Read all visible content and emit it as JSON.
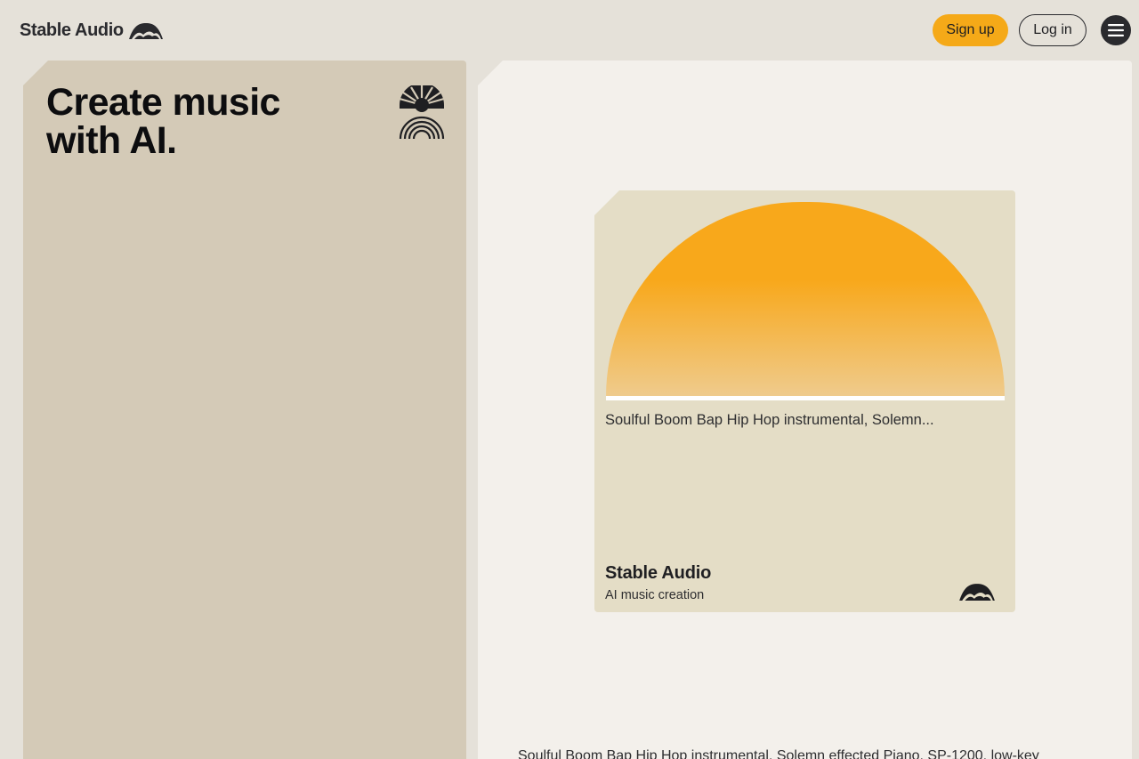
{
  "header": {
    "logo_text": "Stable Audio",
    "signup_label": "Sign up",
    "login_label": "Log in"
  },
  "hero": {
    "title": "Create music with AI."
  },
  "card": {
    "prompt": "Soulful Boom Bap Hip Hop instrumental, Solemn...",
    "brand": "Stable Audio",
    "subtitle": "AI music creation"
  },
  "bottom": {
    "prompt_full": "Soulful Boom Bap Hip Hop instrumental, Solemn effected Piano, SP-1200, low-key"
  },
  "colors": {
    "accent": "#f5a918",
    "left_panel": "#d4cab7",
    "right_panel": "#f3f0eb",
    "card": "#e4ddc6"
  },
  "icons": {
    "logo": "hills-logo-icon",
    "menu": "hamburger-menu-icon",
    "decoration": "sunrise-rainbow-icon"
  }
}
